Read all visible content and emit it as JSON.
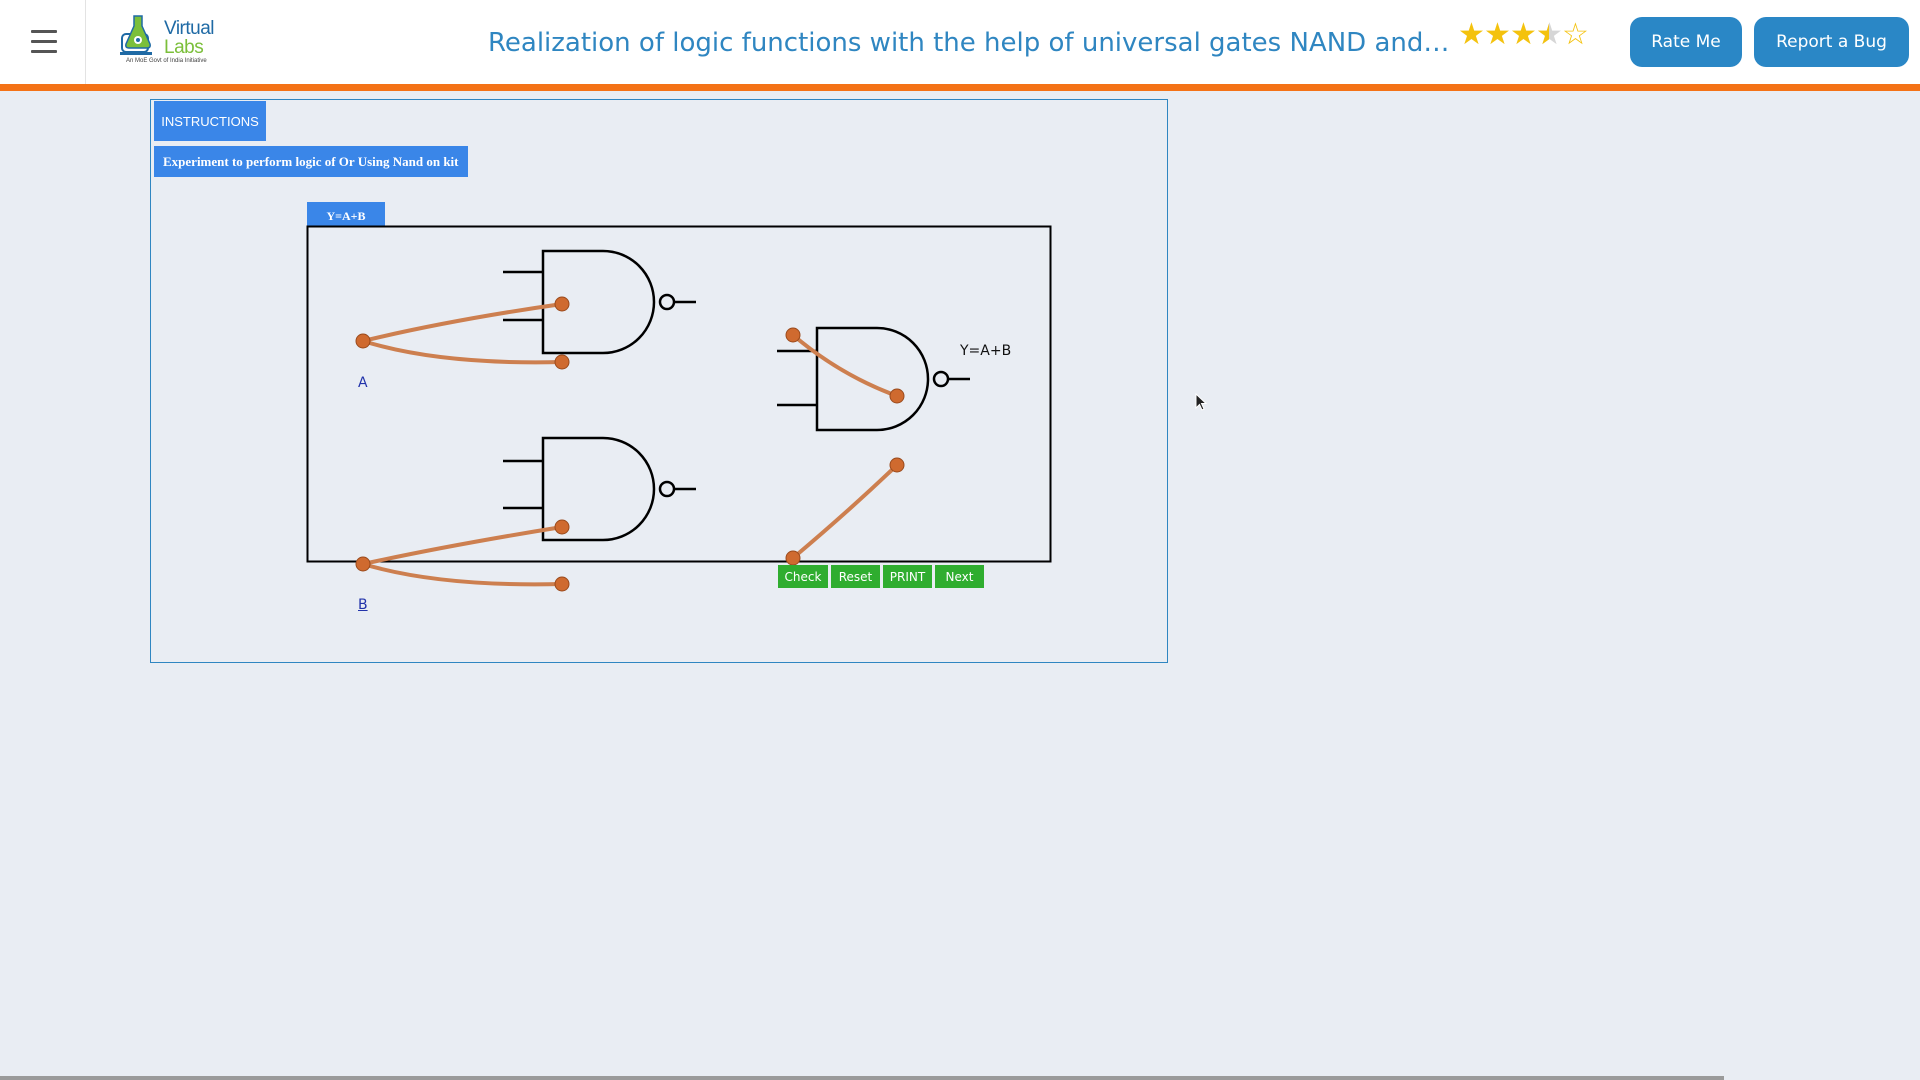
{
  "header": {
    "logo": {
      "line1": "Virtual",
      "line2": "Labs",
      "tagline": "An MoE Govt of India Initiative"
    },
    "title": "Realization of logic functions with the help of universal gates NAND and NOR",
    "rating": 3.5,
    "rating_max": 5,
    "rate_button": "Rate Me",
    "report_button": "Report a Bug"
  },
  "experiment": {
    "instructions_button": "INSTRUCTIONS",
    "heading": "Experiment to perform logic of Or Using Nand on kit",
    "tab_label": "Y=A+B",
    "input_a": "A",
    "input_b": "B",
    "output_label": "Y=A+B",
    "controls": {
      "check": "Check",
      "reset": "Reset",
      "print": "PRINT",
      "next": "Next"
    },
    "gates": [
      "NAND",
      "NAND",
      "NAND"
    ],
    "wire_color": "#cd7f4f",
    "terminal_color": "#cf6a2f"
  },
  "colors": {
    "accent": "#2f86c1",
    "header_bar": "#f47216",
    "label_bg": "#3a86e8",
    "control_bg": "#2fad2f"
  }
}
